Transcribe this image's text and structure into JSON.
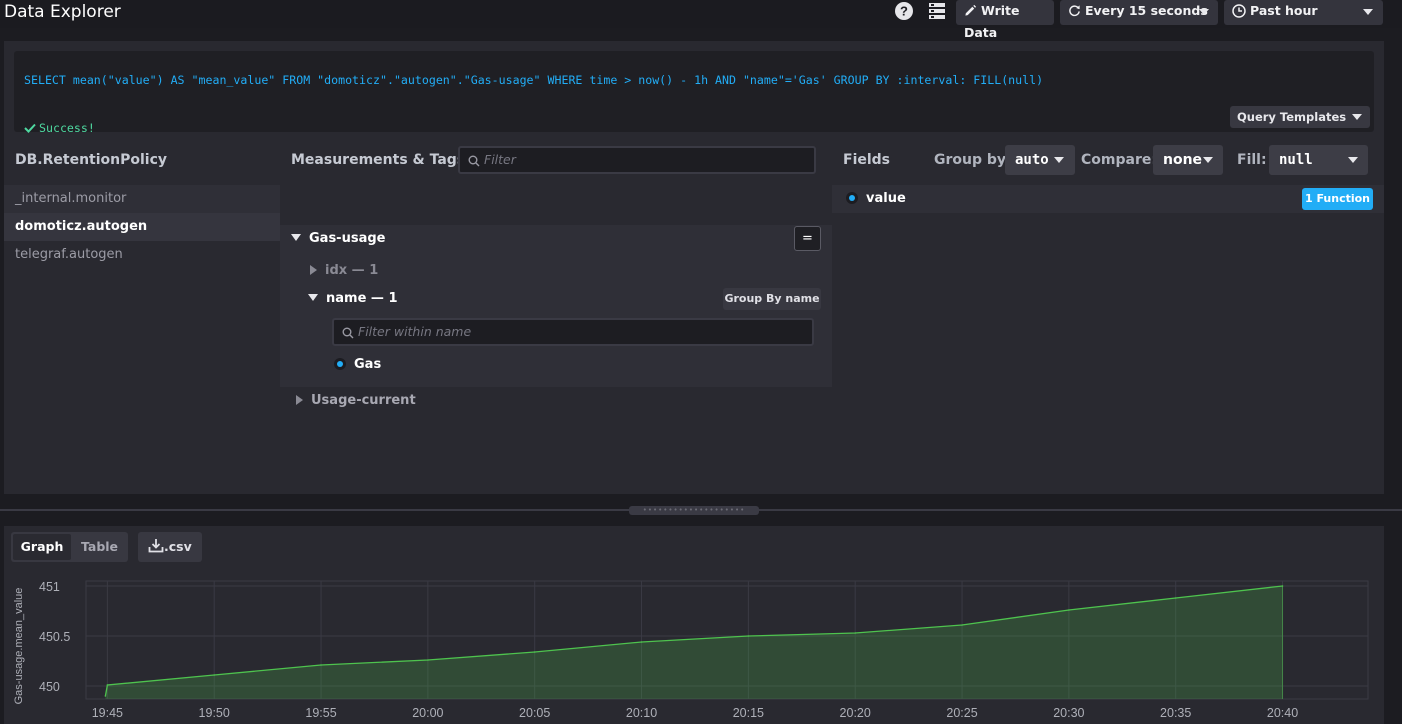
{
  "header": {
    "title": "Data Explorer",
    "write_data_label": "Write Data",
    "refresh_label": "Every 15 seconds",
    "time_range_label": "Past hour"
  },
  "query": {
    "text": "SELECT mean(\"value\") AS \"mean_value\" FROM \"domoticz\".\"autogen\".\"Gas-usage\" WHERE time > now() - 1h AND \"name\"='Gas' GROUP BY :interval: FILL(null)",
    "status": "Success!",
    "templates_label": "Query Templates"
  },
  "db_panel": {
    "header": "DB.RetentionPolicy",
    "items": [
      {
        "label": "_internal.monitor",
        "active": false
      },
      {
        "label": "domoticz.autogen",
        "active": true
      },
      {
        "label": "telegraf.autogen",
        "active": false
      }
    ]
  },
  "measurements_panel": {
    "header": "Measurements & Tags",
    "filter_placeholder": "Filter",
    "equals_label": "=",
    "measurement": "Gas-usage",
    "tags": [
      {
        "label": "idx — 1",
        "expanded": false
      },
      {
        "label": "name — 1",
        "expanded": true
      }
    ],
    "group_by_name_label": "Group By name",
    "tag_filter_placeholder": "Filter within name",
    "tag_value": "Gas",
    "other_measurement": "Usage-current"
  },
  "fields_panel": {
    "header": "Fields",
    "group_by_label": "Group by:",
    "group_by_value": "auto",
    "compare_label": "Compare:",
    "compare_value": "none",
    "fill_label": "Fill:",
    "fill_value": "null",
    "field": "value",
    "function_badge": "1 Function"
  },
  "results": {
    "graph_tab": "Graph",
    "table_tab": "Table",
    "active_tab": "Graph",
    "csv_label": ".csv"
  },
  "colors": {
    "accent": "#22adf6",
    "success": "#4ed8a0",
    "line": "#4ec34e"
  },
  "chart_data": {
    "type": "area",
    "ylabel": "Gas-usage.mean_value",
    "x_ticks": [
      "19:45",
      "19:50",
      "19:55",
      "20:00",
      "20:05",
      "20:10",
      "20:15",
      "20:20",
      "20:25",
      "20:30",
      "20:35",
      "20:40"
    ],
    "y_ticks": [
      "451",
      "450.5",
      "450"
    ],
    "ylim": [
      449.87,
      451.05
    ],
    "xlim": [
      "19:44",
      "20:44"
    ],
    "series": [
      {
        "x": [
          "19:45",
          "19:45",
          "19:50",
          "19:55",
          "20:00",
          "20:05",
          "20:10",
          "20:15",
          "20:20",
          "20:25",
          "20:30",
          "20:35",
          "20:40"
        ],
        "values": [
          449.9,
          450.01,
          450.11,
          450.21,
          450.26,
          450.34,
          450.44,
          450.5,
          450.53,
          450.61,
          450.76,
          450.88,
          451.0
        ]
      }
    ]
  }
}
